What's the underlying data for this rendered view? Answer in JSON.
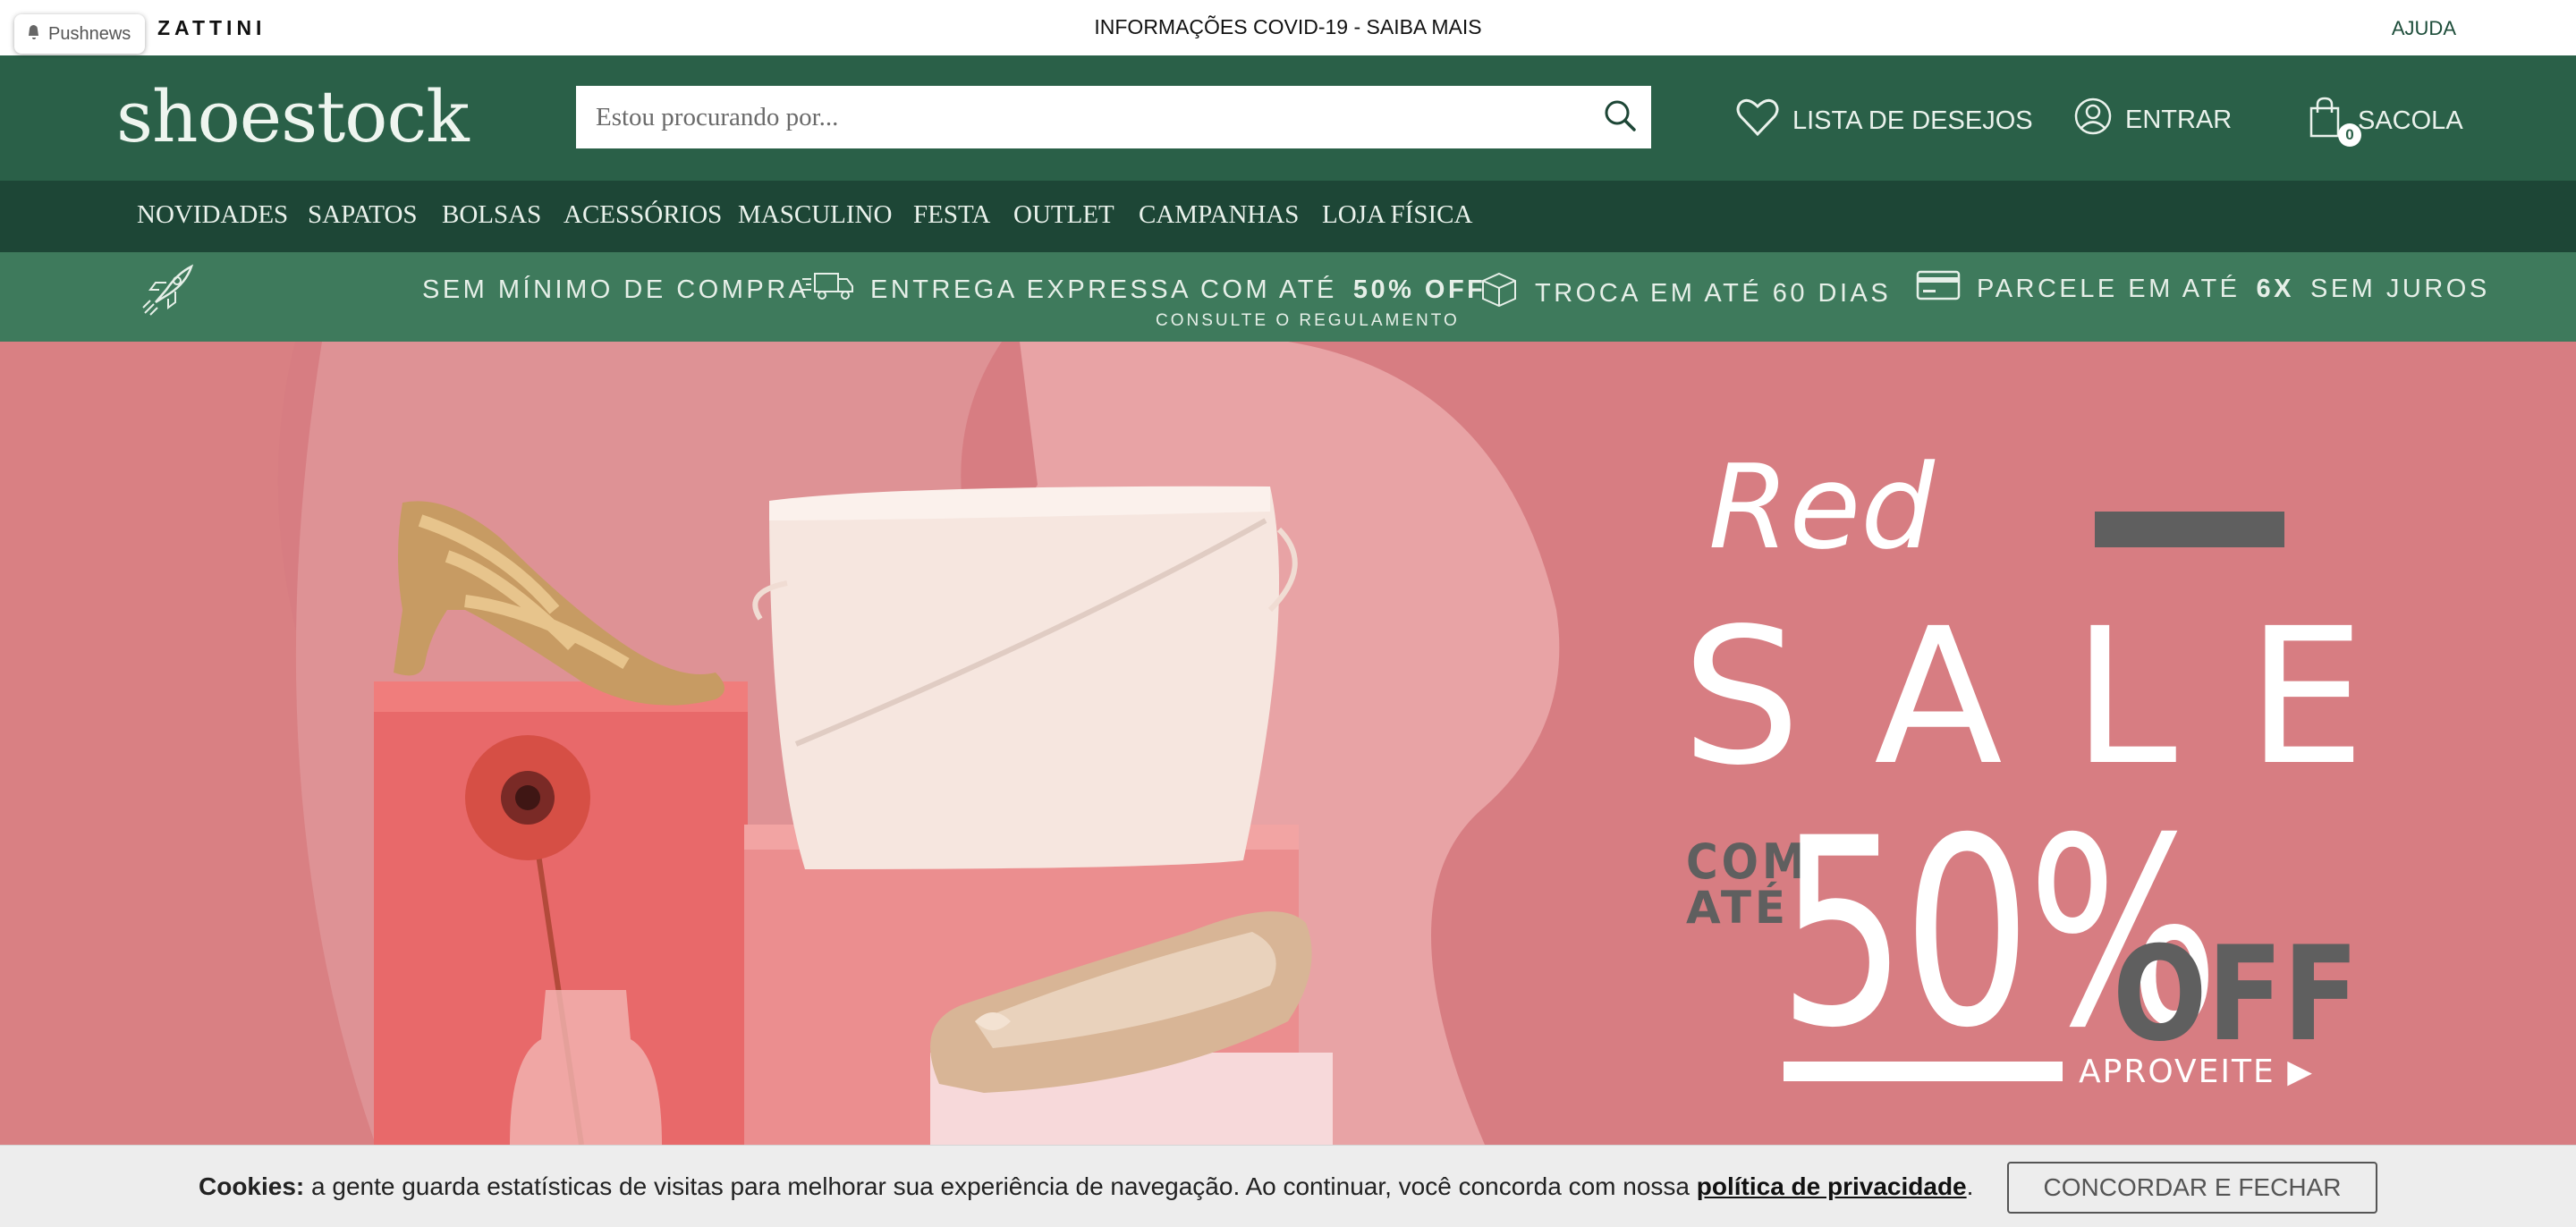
{
  "topbar": {
    "pushnews_label": "Pushnews",
    "zattini_label": "ZATTINI",
    "covid_label": "INFORMAÇÕES COVID-19 - SAIBA MAIS",
    "help_label": "AJUDA"
  },
  "header": {
    "logo": "shoestock",
    "search_placeholder": "Estou procurando por...",
    "wishlist_label": "LISTA DE DESEJOS",
    "login_label": "ENTRAR",
    "bag_label": "SACOLA",
    "bag_count": "0"
  },
  "nav": {
    "items": [
      "NOVIDADES",
      "SAPATOS",
      "BOLSAS",
      "ACESSÓRIOS",
      "MASCULINO",
      "FESTA",
      "OUTLET",
      "CAMPANHAS",
      "LOJA FÍSICA"
    ]
  },
  "benefits": {
    "no_minimum": "SEM MÍNIMO DE COMPRA",
    "express_prefix": "ENTREGA EXPRESSA COM ATÉ",
    "express_bold": "50% OFF",
    "express_sub": "CONSULTE O REGULAMENTO",
    "exchange": "TROCA EM ATÉ 60 DIAS",
    "installments_prefix": "PARCELE EM ATÉ",
    "installments_bold": "6X",
    "installments_suffix": "SEM JUROS"
  },
  "banner": {
    "script_word": "Red",
    "sale_word": "SALE",
    "com_word": "COM",
    "ate_word": "ATÉ",
    "percent": "50%",
    "off_word": "OFF",
    "cta": "APROVEITE ▶",
    "colors": {
      "background": "#d77d82",
      "box": "#e8868a",
      "text": "#ffffff",
      "off": "#5f5f5f"
    }
  },
  "cookie": {
    "label": "Cookies:",
    "text": "a gente guarda estatísticas de visitas para melhorar sua experiência de navegação. Ao continuar, você concorda com nossa",
    "link": "política de privacidade",
    "period": ".",
    "button": "CONCORDAR E FECHAR"
  },
  "colors": {
    "header": "#2a6048",
    "nav": "#1d4636",
    "benefits": "#3e7a5c"
  }
}
